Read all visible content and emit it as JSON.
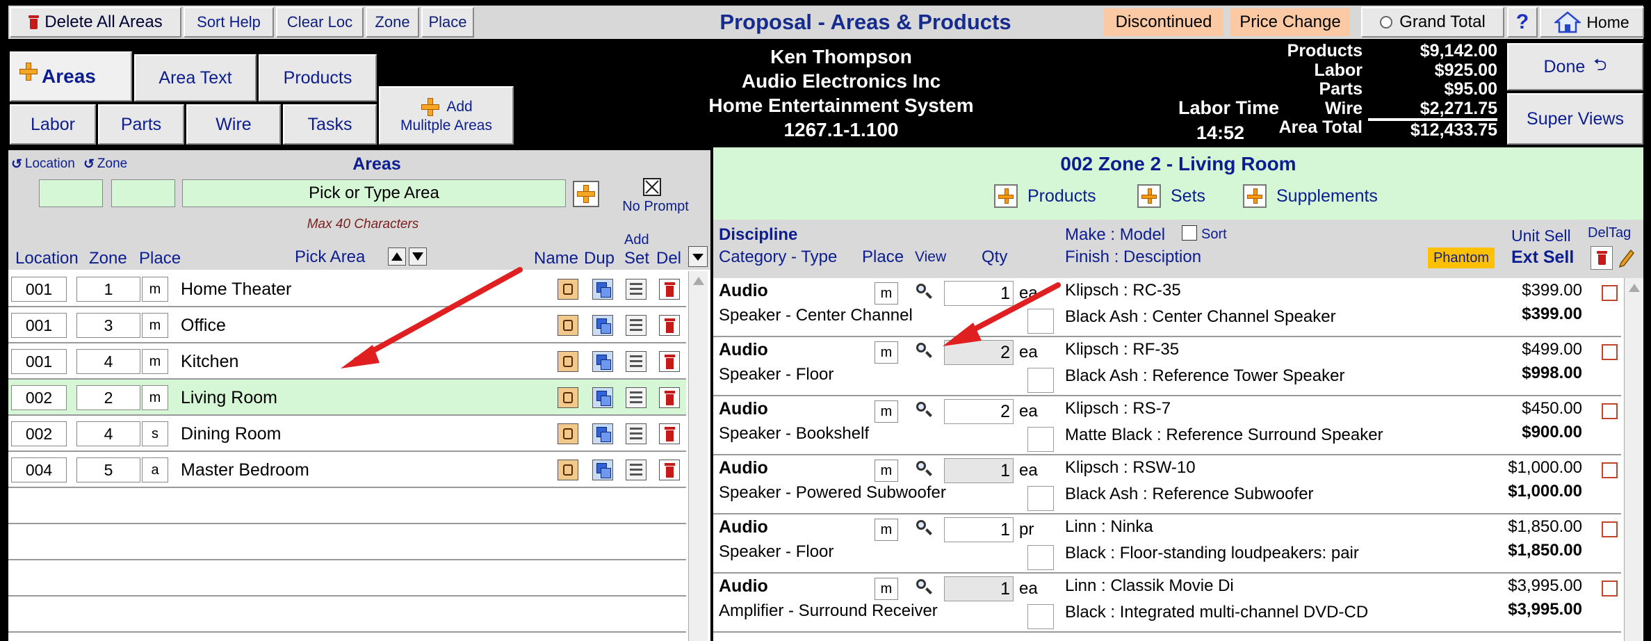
{
  "toolbar": {
    "delete_all": "Delete All Areas",
    "sort_help": "Sort Help",
    "clear_loc": "Clear Loc",
    "zone": "Zone",
    "place": "Place",
    "title": "Proposal - Areas & Products",
    "discontinued": "Discontinued",
    "price_change": "Price Change",
    "grand_total": "Grand Total",
    "help": "?",
    "home": "Home"
  },
  "tabs": {
    "areas": "Areas",
    "area_text": "Area Text",
    "products": "Products",
    "labor": "Labor",
    "parts": "Parts",
    "wire": "Wire",
    "tasks": "Tasks",
    "add_line1": "Add",
    "add_line2": "Mulitple Areas"
  },
  "client": {
    "name": "Ken Thompson",
    "company": "Audio Electronics Inc",
    "system": "Home Entertainment System",
    "number": "1267.1-1.100"
  },
  "totals": {
    "labor_time_label": "Labor Time",
    "labor_time": "14:52",
    "rows": [
      {
        "label": "Products",
        "value": "$9,142.00"
      },
      {
        "label": "Labor",
        "value": "$925.00"
      },
      {
        "label": "Parts",
        "value": "$95.00"
      },
      {
        "label": "Wire",
        "value": "$2,271.75"
      },
      {
        "label": "Area Total",
        "value": "$12,433.75"
      }
    ]
  },
  "side_buttons": {
    "done": "Done",
    "super_views": "Super Views"
  },
  "areas_panel": {
    "location_label": "Location",
    "zone_label": "Zone",
    "areas_title": "Areas",
    "pick_placeholder": "Pick or Type Area",
    "max_chars": "Max 40 Characters",
    "no_prompt": "No Prompt",
    "col_location": "Location",
    "col_zone": "Zone",
    "col_place": "Place",
    "col_pick_area": "Pick Area",
    "col_name": "Name",
    "col_dup": "Dup",
    "col_add": "Add",
    "col_set": "Set",
    "col_del": "Del",
    "rows": [
      {
        "loc": "001",
        "zone": "1",
        "place": "m",
        "name": "Home Theater"
      },
      {
        "loc": "001",
        "zone": "3",
        "place": "m",
        "name": "Office"
      },
      {
        "loc": "001",
        "zone": "4",
        "place": "m",
        "name": "Kitchen"
      },
      {
        "loc": "002",
        "zone": "2",
        "place": "m",
        "name": "Living Room"
      },
      {
        "loc": "002",
        "zone": "4",
        "place": "s",
        "name": "Dining Room"
      },
      {
        "loc": "004",
        "zone": "5",
        "place": "a",
        "name": "Master Bedroom"
      }
    ]
  },
  "products_panel": {
    "title": "002 Zone 2 - Living Room",
    "btn_products": "Products",
    "btn_sets": "Sets",
    "btn_supplements": "Supplements",
    "h_discipline": "Discipline",
    "h_cat_type": "Category - Type",
    "h_place": "Place",
    "h_view": "View",
    "h_qty": "Qty",
    "h_make_model": "Make : Model",
    "h_sort": "Sort",
    "h_finish_desc": "Finish : Desciption",
    "h_phantom": "Phantom",
    "h_unit_sell": "Unit Sell",
    "h_ext_sell": "Ext Sell",
    "h_del_tag": "DelTag",
    "rows": [
      {
        "discipline": "Audio",
        "category": "Speaker - Center Channel",
        "place": "m",
        "qty": "1",
        "unit": "ea",
        "make_model": "Klipsch : RC-35",
        "finish": "Black Ash : Center Channel Speaker",
        "unit_sell": "$399.00",
        "ext_sell": "$399.00"
      },
      {
        "discipline": "Audio",
        "category": "Speaker - Floor",
        "place": "m",
        "qty": "2",
        "unit": "ea",
        "make_model": "Klipsch : RF-35",
        "finish": "Black Ash : Reference Tower Speaker",
        "unit_sell": "$499.00",
        "ext_sell": "$998.00"
      },
      {
        "discipline": "Audio",
        "category": "Speaker - Bookshelf",
        "place": "m",
        "qty": "2",
        "unit": "ea",
        "make_model": "Klipsch : RS-7",
        "finish": "Matte Black : Reference Surround Speaker",
        "unit_sell": "$450.00",
        "ext_sell": "$900.00"
      },
      {
        "discipline": "Audio",
        "category": "Speaker - Powered Subwoofer",
        "place": "m",
        "qty": "1",
        "unit": "ea",
        "make_model": "Klipsch : RSW-10",
        "finish": "Black Ash : Reference Subwoofer",
        "unit_sell": "$1,000.00",
        "ext_sell": "$1,000.00"
      },
      {
        "discipline": "Audio",
        "category": "Speaker - Floor",
        "place": "m",
        "qty": "1",
        "unit": "pr",
        "make_model": "Linn : Ninka",
        "finish": "Black : Floor-standing loudpeakers: pair",
        "unit_sell": "$1,850.00",
        "ext_sell": "$1,850.00"
      },
      {
        "discipline": "Audio",
        "category": "Amplifier - Surround Receiver",
        "place": "m",
        "qty": "1",
        "unit": "ea",
        "make_model": "Linn : Classik Movie Di",
        "finish": "Black : Integrated multi-channel DVD-CD",
        "unit_sell": "$3,995.00",
        "ext_sell": "$3,995.00"
      }
    ]
  },
  "colors": {
    "accent_green": "#d6f7d6",
    "highlight_orange": "#fbc9a4",
    "phantom_yellow": "#ffc000",
    "annotation_red": "#e02020"
  }
}
